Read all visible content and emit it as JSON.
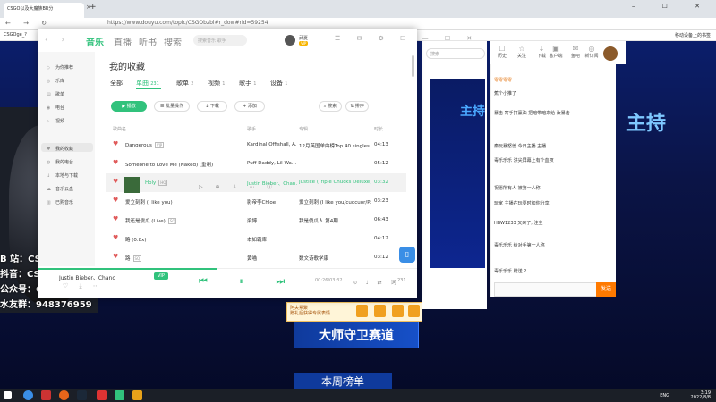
{
  "browser": {
    "tab_title": "CSGO以及大魔族BR分",
    "tab_close": "×",
    "new_tab": "+",
    "window_controls": "– ☐ ✕",
    "nav": "← → ↻",
    "url": "https://www.douyu.com/topic/CSGObzbl#r_dow#rid=59254",
    "bookmark_left": "CSGOge_?",
    "bookmark_right": "移动设备上的书签"
  },
  "stream": {
    "info_lines": [
      "B 站：CSGO三哥",
      "抖音：CSGO三哥",
      "公众号：CSGO三哥",
      "水友群：948376959"
    ],
    "side_search": "搜索",
    "thumb_text": "主持",
    "big_title": "主持",
    "banner_title": "大师守卫赛道",
    "banner_sub": "本周榜单",
    "gift_label_1": "阿夫累聚",
    "gift_label_2": "赠礼后获得专属表情",
    "top_icons": [
      {
        "label": "历史",
        "icon": "☐"
      },
      {
        "label": "关注",
        "icon": "☆"
      },
      {
        "label": "下载",
        "icon": "↓"
      },
      {
        "label": "客户端",
        "icon": "▣"
      },
      {
        "label": "鱼吧",
        "icon": "✉"
      },
      {
        "label": "新订阅",
        "icon": "◎"
      }
    ],
    "chat": [
      {
        "user": "零零零零",
        "text": ""
      },
      {
        "user": "",
        "text": "蕉个小推了"
      },
      {
        "user": "",
        "text": "暴击 寄手打赢油 把暗带暗来给 汝暴击"
      },
      {
        "user": "",
        "text": "秦玩暴怒兽 今日主播 主播"
      },
      {
        "user": "",
        "text": "毒乐乐乐 洪尖屏幕上有个血衩"
      },
      {
        "user": "",
        "text": "祝愿所有人 被第一人称"
      },
      {
        "user": "",
        "text": "玩家 主播在玩耍时和你分享"
      },
      {
        "user": "",
        "text": "HBW1233 又来了, 注主"
      },
      {
        "user": "",
        "text": "毒乐乐乐 给对手第一人称"
      },
      {
        "user": "",
        "text": "毒乐乐乐 赠送 2"
      }
    ],
    "send_label": "发送"
  },
  "music": {
    "tabs": [
      "音乐",
      "直播",
      "听书",
      "搜索"
    ],
    "search_placeholder": "搜索音乐 歌手",
    "user_name": "武夏",
    "user_badge": "VIP",
    "window_icons": "☰ ✉ ⚙ ☐ — ☐ ✕",
    "back_icons": "‹ ›",
    "sidebar": [
      {
        "label": "为你推荐",
        "icon": "◇"
      },
      {
        "label": "乐库",
        "icon": "◎"
      },
      {
        "label": "歌单",
        "icon": "▤"
      },
      {
        "label": "电台",
        "icon": "◉"
      },
      {
        "label": "视频",
        "icon": "▷"
      },
      {
        "label": "我的收藏",
        "icon": "♥"
      },
      {
        "label": "我的电台",
        "icon": "◍"
      },
      {
        "label": "本地与下载",
        "icon": "↓"
      },
      {
        "label": "音乐云盘",
        "icon": "☁"
      },
      {
        "label": "已购音乐",
        "icon": "▥"
      }
    ],
    "page_title": "我的收藏",
    "subtabs": [
      {
        "label": "全部",
        "count": ""
      },
      {
        "label": "单曲",
        "count": "231"
      },
      {
        "label": "歌单",
        "count": "2"
      },
      {
        "label": "视频",
        "count": "1"
      },
      {
        "label": "歌手",
        "count": "1"
      },
      {
        "label": "设备",
        "count": "1"
      }
    ],
    "play_all": "▶ 播放",
    "batch": "☰ 批量操作",
    "download": "↓ 下载",
    "add": "+ 添加",
    "search_btn": "⌕ 搜索",
    "sort_btn": "⇅ 排序",
    "list_header": {
      "title": "歌曲名",
      "artist": "歌手",
      "album": "专辑",
      "duration": "时长"
    },
    "songs": [
      {
        "title": "Dangerous",
        "tag": "VIP",
        "artist": "Kardinal Offishall, A...",
        "album": "12月英国单曲榜Top 40 singles",
        "duration": "04:13"
      },
      {
        "title": "Someone to Love Me (Naked) (重制)",
        "tag": "",
        "artist": "Puff Daddy, Lil Wa...",
        "album": "",
        "duration": "05:12"
      },
      {
        "title": "Holy",
        "tag": "HQ",
        "artist": "Justin Bieber、Chan...",
        "album": "Justice (Triple Chucks Deluxe)...",
        "duration": "03:32"
      },
      {
        "title": "爱立刻刺 (I like you)",
        "tag": "",
        "artist": "影帝李Chloe",
        "album": "爱立刻刺 (I like you/cuocuor/P...",
        "duration": "03:23"
      },
      {
        "title": "我还是傻瓜 (Live)",
        "tag": "SQ",
        "artist": "梁博",
        "album": "我是傻瓜人 第4期",
        "duration": "06:43"
      },
      {
        "title": "路 (0.8x)",
        "tag": "",
        "artist": "本如霸库",
        "album": "",
        "duration": "04:12"
      },
      {
        "title": "路",
        "tag": "SQ",
        "artist": "黄喵",
        "album": "数文诗歌学康",
        "duration": "03:12"
      }
    ],
    "row_icons": "▷ ⊕ ↓ ⋯ ⓘ",
    "player": {
      "now_playing": "Justin Bieber、Chanc",
      "vip": "VIP",
      "fav_icons": "♡ ⤓ ⋯",
      "controls": "⏮ ⏸ ⏭",
      "time": "00:26/03:32",
      "right_icons": "⊙ ♩ ⇄ 词",
      "count": "231"
    },
    "float_icon": "▯"
  },
  "taskbar": {
    "time": "3:19",
    "date": "2022/8/8",
    "lang": "ENG"
  },
  "colors": {
    "accent": "#31c27c",
    "douyu_orange": "#ff7a00"
  }
}
